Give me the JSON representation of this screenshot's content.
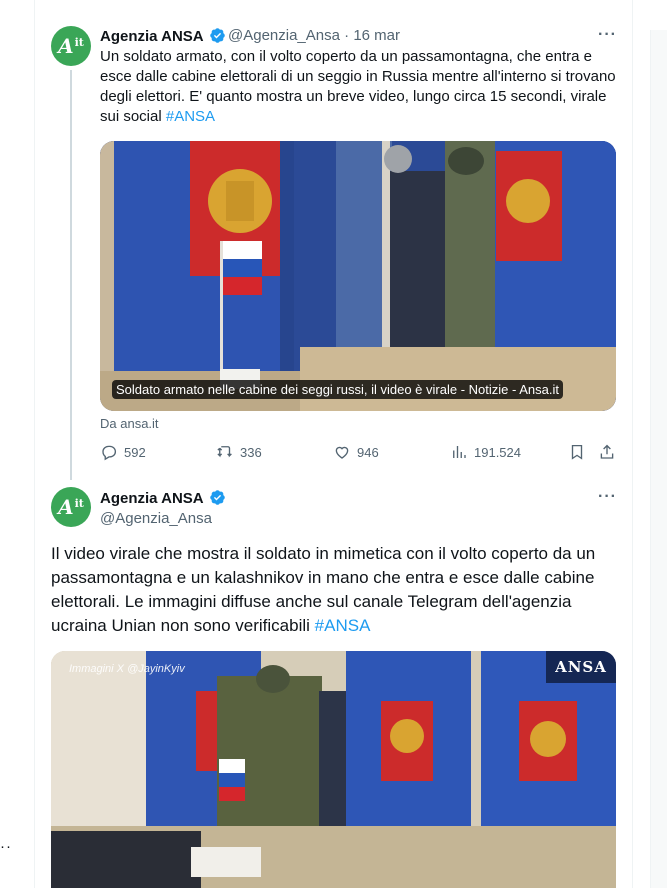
{
  "tweet1": {
    "author_name": "Agenzia ANSA",
    "author_handle": "@Agenzia_Ansa",
    "separator": "·",
    "date": "16 mar",
    "text": "Un soldato armato, con il volto coperto da un passamontagna, che entra e esce dalle cabine elettorali di un seggio in Russia mentre all'interno si trovano degli elettori.  E' quanto mostra un breve video, lungo circa 15 secondi, virale sui social ",
    "hashtag": "#ANSA",
    "card_caption": "Soldato armato nelle cabine dei seggi russi, il video è virale - Notizie - Ansa.it",
    "card_source": "Da ansa.it",
    "replies": "592",
    "reposts": "336",
    "likes": "946",
    "views": "191.524"
  },
  "tweet2": {
    "author_name": "Agenzia ANSA",
    "author_handle": "@Agenzia_Ansa",
    "text": "Il video virale che mostra il soldato in mimetica con il volto coperto da un passamontagna e un kalashnikov in mano che entra e esce dalle cabine elettorali. Le immagini diffuse anche sul canale Telegram dell'agenzia ucraina Unian non sono verificabili ",
    "hashtag": "#ANSA",
    "media_watermark": "Immagini X @JayinKyiv",
    "media_logo": "ANSA"
  },
  "avatar": {
    "big": "A",
    "small": "it"
  },
  "more_label": "···",
  "left_more_label": "··",
  "colors": {
    "accent": "#1d9bf0",
    "avatar_green": "#3aa657",
    "muted": "#536471"
  },
  "icons": [
    "verified-badge-icon",
    "more-icon",
    "reply-icon",
    "repost-icon",
    "like-icon",
    "views-icon",
    "bookmark-icon",
    "share-icon"
  ]
}
